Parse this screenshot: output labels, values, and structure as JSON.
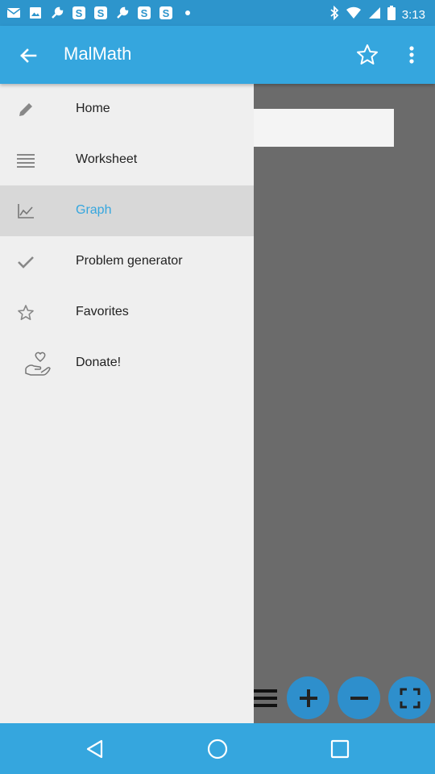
{
  "status_bar": {
    "time": "3:13",
    "icons": [
      "email-icon",
      "image-icon",
      "wrench-icon",
      "app-s-icon",
      "app-s-icon",
      "wrench-icon",
      "app-s-icon",
      "app-s-icon",
      "dot-icon"
    ],
    "right_icons": [
      "bluetooth-icon",
      "wifi-icon",
      "signal-icon",
      "battery-icon"
    ]
  },
  "app_bar": {
    "title": "MalMath",
    "back_icon": "arrow-back-icon",
    "favorite_icon": "star-outline-icon",
    "more_icon": "more-vert-icon"
  },
  "drawer": {
    "items": [
      {
        "label": "Home",
        "icon": "pencil-icon",
        "active": false
      },
      {
        "label": "Worksheet",
        "icon": "list-lines-icon",
        "active": false
      },
      {
        "label": "Graph",
        "icon": "graph-icon",
        "active": true
      },
      {
        "label": "Problem generator",
        "icon": "check-icon",
        "active": false
      },
      {
        "label": "Favorites",
        "icon": "star-outline-icon",
        "active": false
      },
      {
        "label": "Donate!",
        "icon": "hand-heart-icon",
        "active": false
      }
    ]
  },
  "graph_toolbar": {
    "buttons": [
      "menu-icon",
      "zoom-in-icon",
      "zoom-out-icon",
      "fullscreen-icon"
    ]
  },
  "nav_bar": {
    "buttons": [
      "back-triangle-icon",
      "home-circle-icon",
      "recents-square-icon"
    ]
  },
  "colors": {
    "status_bar": "#2d95cc",
    "app_bar": "#35a6de",
    "drawer_bg": "#efefef",
    "active_item_bg": "#d8d8d8",
    "scrim": "#6b6b6b",
    "accent_text": "#35a6de",
    "toolbar_button": "#2e8fcc"
  }
}
